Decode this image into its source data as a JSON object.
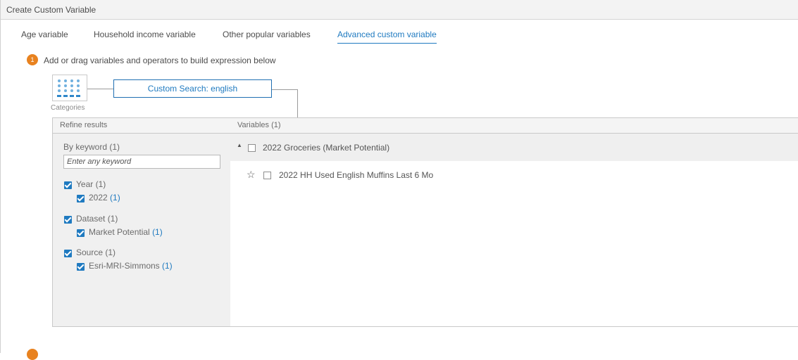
{
  "window": {
    "title": "Create Custom Variable"
  },
  "tabs": [
    {
      "label": "Age variable",
      "active": false
    },
    {
      "label": "Household income variable",
      "active": false
    },
    {
      "label": "Other popular variables",
      "active": false
    },
    {
      "label": "Advanced custom variable",
      "active": true
    }
  ],
  "step1": {
    "number": "1",
    "text": "Add or drag variables and operators to build expression below"
  },
  "categories": {
    "label": "Categories",
    "icon": "grid-icon"
  },
  "custom_search": {
    "label": "Custom Search: english"
  },
  "refine": {
    "header": "Refine results",
    "keyword": {
      "label": "By keyword",
      "count": "(1)",
      "placeholder": "Enter any keyword"
    },
    "filters": [
      {
        "label": "Year",
        "count": "(1)",
        "checked": true,
        "child": {
          "label": "2022",
          "count": "(1)",
          "checked": true
        }
      },
      {
        "label": "Dataset",
        "count": "(1)",
        "checked": true,
        "child": {
          "label": "Market Potential",
          "count": "(1)",
          "checked": true
        }
      },
      {
        "label": "Source",
        "count": "(1)",
        "checked": true,
        "child": {
          "label": "Esri-MRI-Simmons",
          "count": "(1)",
          "checked": true
        }
      }
    ]
  },
  "variables": {
    "header": "Variables (1)",
    "group": {
      "label": "2022 Groceries (Market Potential)",
      "expanded": true
    },
    "items": [
      {
        "label": "2022 HH Used English Muffins Last 6 Mo",
        "favorite": false
      }
    ]
  },
  "colors": {
    "accent": "#1f7ac0",
    "step_badge": "#e8821f"
  }
}
